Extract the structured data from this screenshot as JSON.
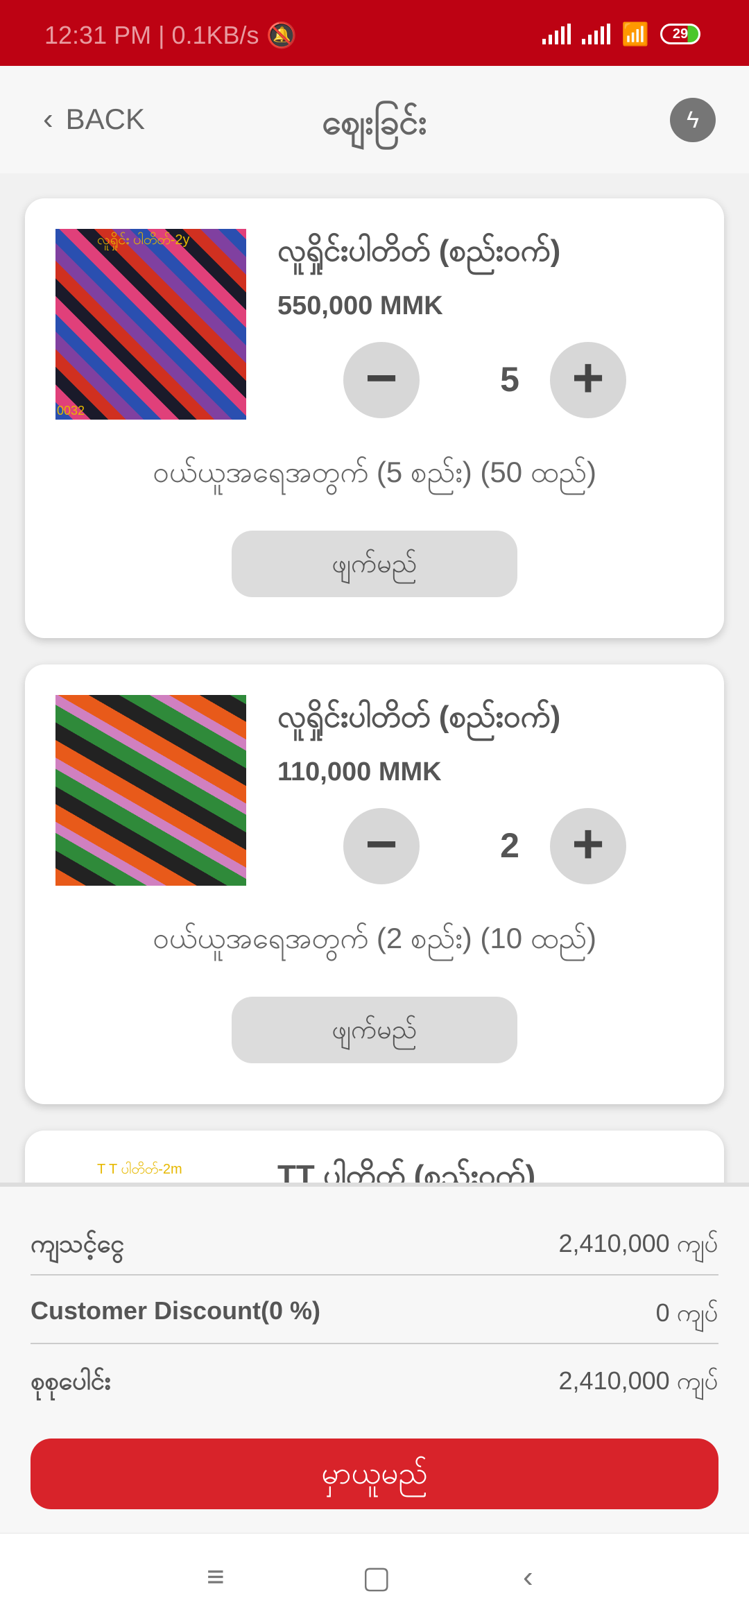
{
  "status": {
    "time": "12:31 PM",
    "net": "0.1KB/s",
    "battery": "29"
  },
  "header": {
    "back": "BACK",
    "title": "ဈေးခြင်း"
  },
  "items": [
    {
      "img_label": "လူရှိုင်း ပါတိတ်-2y",
      "img_code": "0032",
      "title": "လူရှိုင်းပါတိတ် (စည်းဝက်)",
      "price": "550,000 MMK",
      "qty": "5",
      "note": "ဝယ်ယူအရေအတွက် (5 စည်း) (50 ထည်)",
      "delete": "ဖျက်မည်"
    },
    {
      "img_label": "",
      "img_code": "",
      "title": "လူရှိုင်းပါတိတ် (စည်းဝက်)",
      "price": "110,000 MMK",
      "qty": "2",
      "note": "ဝယ်ယူအရေအတွက် (2 စည်း) (10 ထည်)",
      "delete": "ဖျက်မည်"
    },
    {
      "img_label": "T T ပါတိတ်-2m",
      "title": "TT ပါတိတ် (စည်းဝက်)"
    }
  ],
  "summary": {
    "subtotal_label": "ကျသင့်ငွေ",
    "subtotal": "2,410,000 ကျပ်",
    "discount_label": "Customer Discount(0 %)",
    "discount": "0 ကျပ်",
    "total_label": "စုစုပေါင်း",
    "total": "2,410,000 ကျပ်",
    "order": "မှာယူမည်"
  },
  "colors": {
    "status": "#bd0213",
    "accent": "#d8232a"
  }
}
